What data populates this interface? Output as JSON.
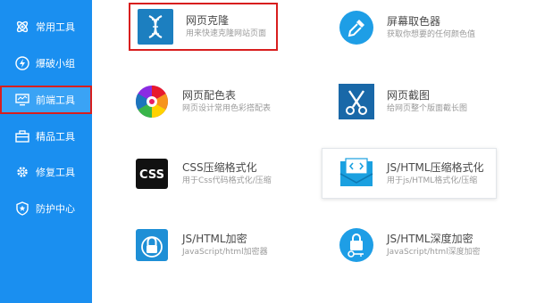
{
  "sidebar": {
    "items": [
      {
        "label": "常用工具",
        "icon": "atom-icon"
      },
      {
        "label": "爆破小组",
        "icon": "lightning-icon"
      },
      {
        "label": "前端工具",
        "icon": "monitor-icon",
        "active": true
      },
      {
        "label": "精品工具",
        "icon": "toolbox-icon"
      },
      {
        "label": "修复工具",
        "icon": "gear-icon"
      },
      {
        "label": "防护中心",
        "icon": "shield-icon"
      }
    ]
  },
  "tools": [
    {
      "name": "网页克隆",
      "desc": "用来快速克隆网站页面",
      "icon": "dna-icon"
    },
    {
      "name": "屏幕取色器",
      "desc": "获取你想要的任何颜色值",
      "icon": "eyedropper-icon"
    },
    {
      "name": "网页配色表",
      "desc": "网页设计常用色彩搭配表",
      "icon": "color-wheel-icon"
    },
    {
      "name": "网页截图",
      "desc": "给网页整个版面截长图",
      "icon": "scissors-icon"
    },
    {
      "name": "CSS压缩格式化",
      "desc": "用于Css代码格式化/压缩",
      "icon": "css-icon",
      "badge": "CSS"
    },
    {
      "name": "JS/HTML压缩格式化",
      "desc": "用于js/HTML格式化/压缩",
      "icon": "code-envelope-icon"
    },
    {
      "name": "JS/HTML加密",
      "desc": "JavaScript/html加密器",
      "icon": "lock-icon"
    },
    {
      "name": "JS/HTML深度加密",
      "desc": "JavaScript/html深度加密",
      "icon": "lock-key-icon"
    }
  ],
  "colors": {
    "sidebar": "#1a8ff0",
    "active": "#3aa3f5",
    "highlight_border": "#d81e1e"
  }
}
